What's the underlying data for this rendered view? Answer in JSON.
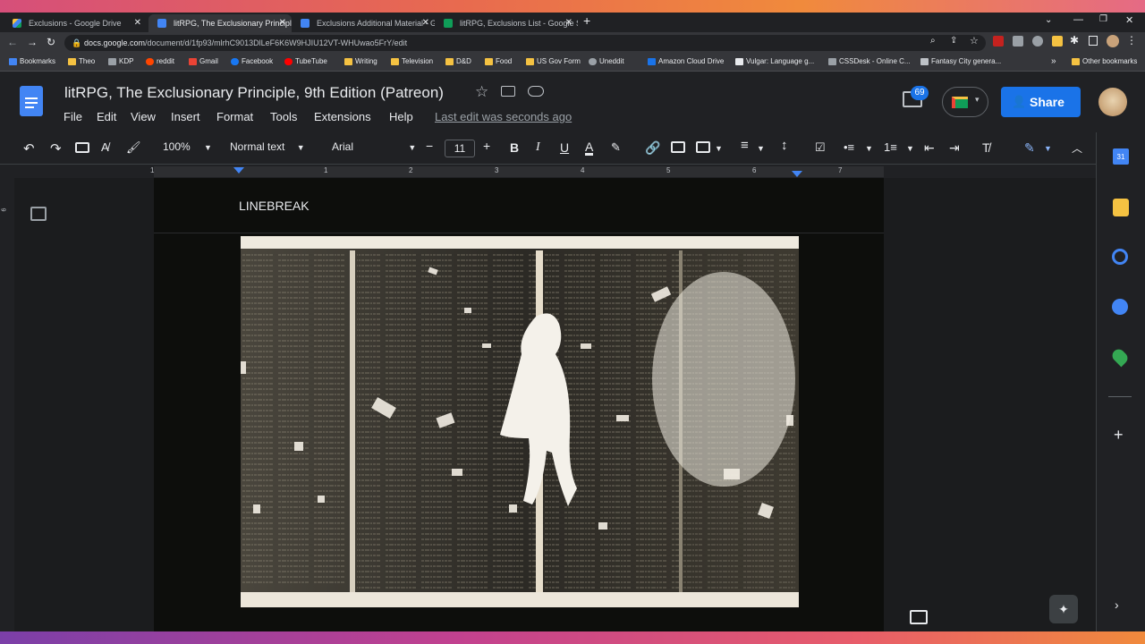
{
  "browser": {
    "tabs": [
      {
        "title": "Exclusions - Google Drive",
        "favicon_color": "#f5c242"
      },
      {
        "title": "litRPG, The Exclusionary Principle",
        "favicon_color": "#4285f4"
      },
      {
        "title": "Exclusions Additional Material - G",
        "favicon_color": "#4285f4"
      },
      {
        "title": "litRPG, Exclusions List - Google S",
        "favicon_color": "#0f9d58"
      }
    ],
    "new_tab": "+",
    "url_host": "docs.google.com",
    "url_path": "/document/d/1fp93/mlrhC9013DlLeF6K6W9HJIU12VT-WHUwao5FrY/edit",
    "bookmarks": [
      "Bookmarks",
      "Theo",
      "KDP",
      "reddit",
      "Gmail",
      "Facebook",
      "TubeTube",
      "Writing",
      "Television",
      "D&D",
      "Food",
      "US Gov Form",
      "Uneddit",
      "Amazon Cloud Drive",
      "Vulgar: Language g...",
      "CSSDesk - Online C...",
      "Fantasy City genera..."
    ],
    "more_bookmarks": "»",
    "other_bookmarks": "Other bookmarks"
  },
  "doc": {
    "title": "litRPG, The Exclusionary Principle, 9th Edition (Patreon)",
    "menus": [
      "File",
      "Edit",
      "View",
      "Insert",
      "Format",
      "Tools",
      "Extensions",
      "Help"
    ],
    "last_edit": "Last edit was seconds ago",
    "comment_count": "69",
    "share_label": "Share"
  },
  "toolbar": {
    "zoom": "100%",
    "style": "Normal text",
    "font": "Arial",
    "font_size": "11",
    "minus": "−",
    "plus": "+"
  },
  "ruler": {
    "numbers": [
      "1",
      "1",
      "2",
      "3",
      "4",
      "5",
      "6",
      "7"
    ],
    "left_number": "6"
  },
  "content": {
    "linebreak_text": "LINEBREAK"
  },
  "colors": {
    "accent": "#1a73e8",
    "background": "#202124",
    "page": "#0d0e0c"
  }
}
